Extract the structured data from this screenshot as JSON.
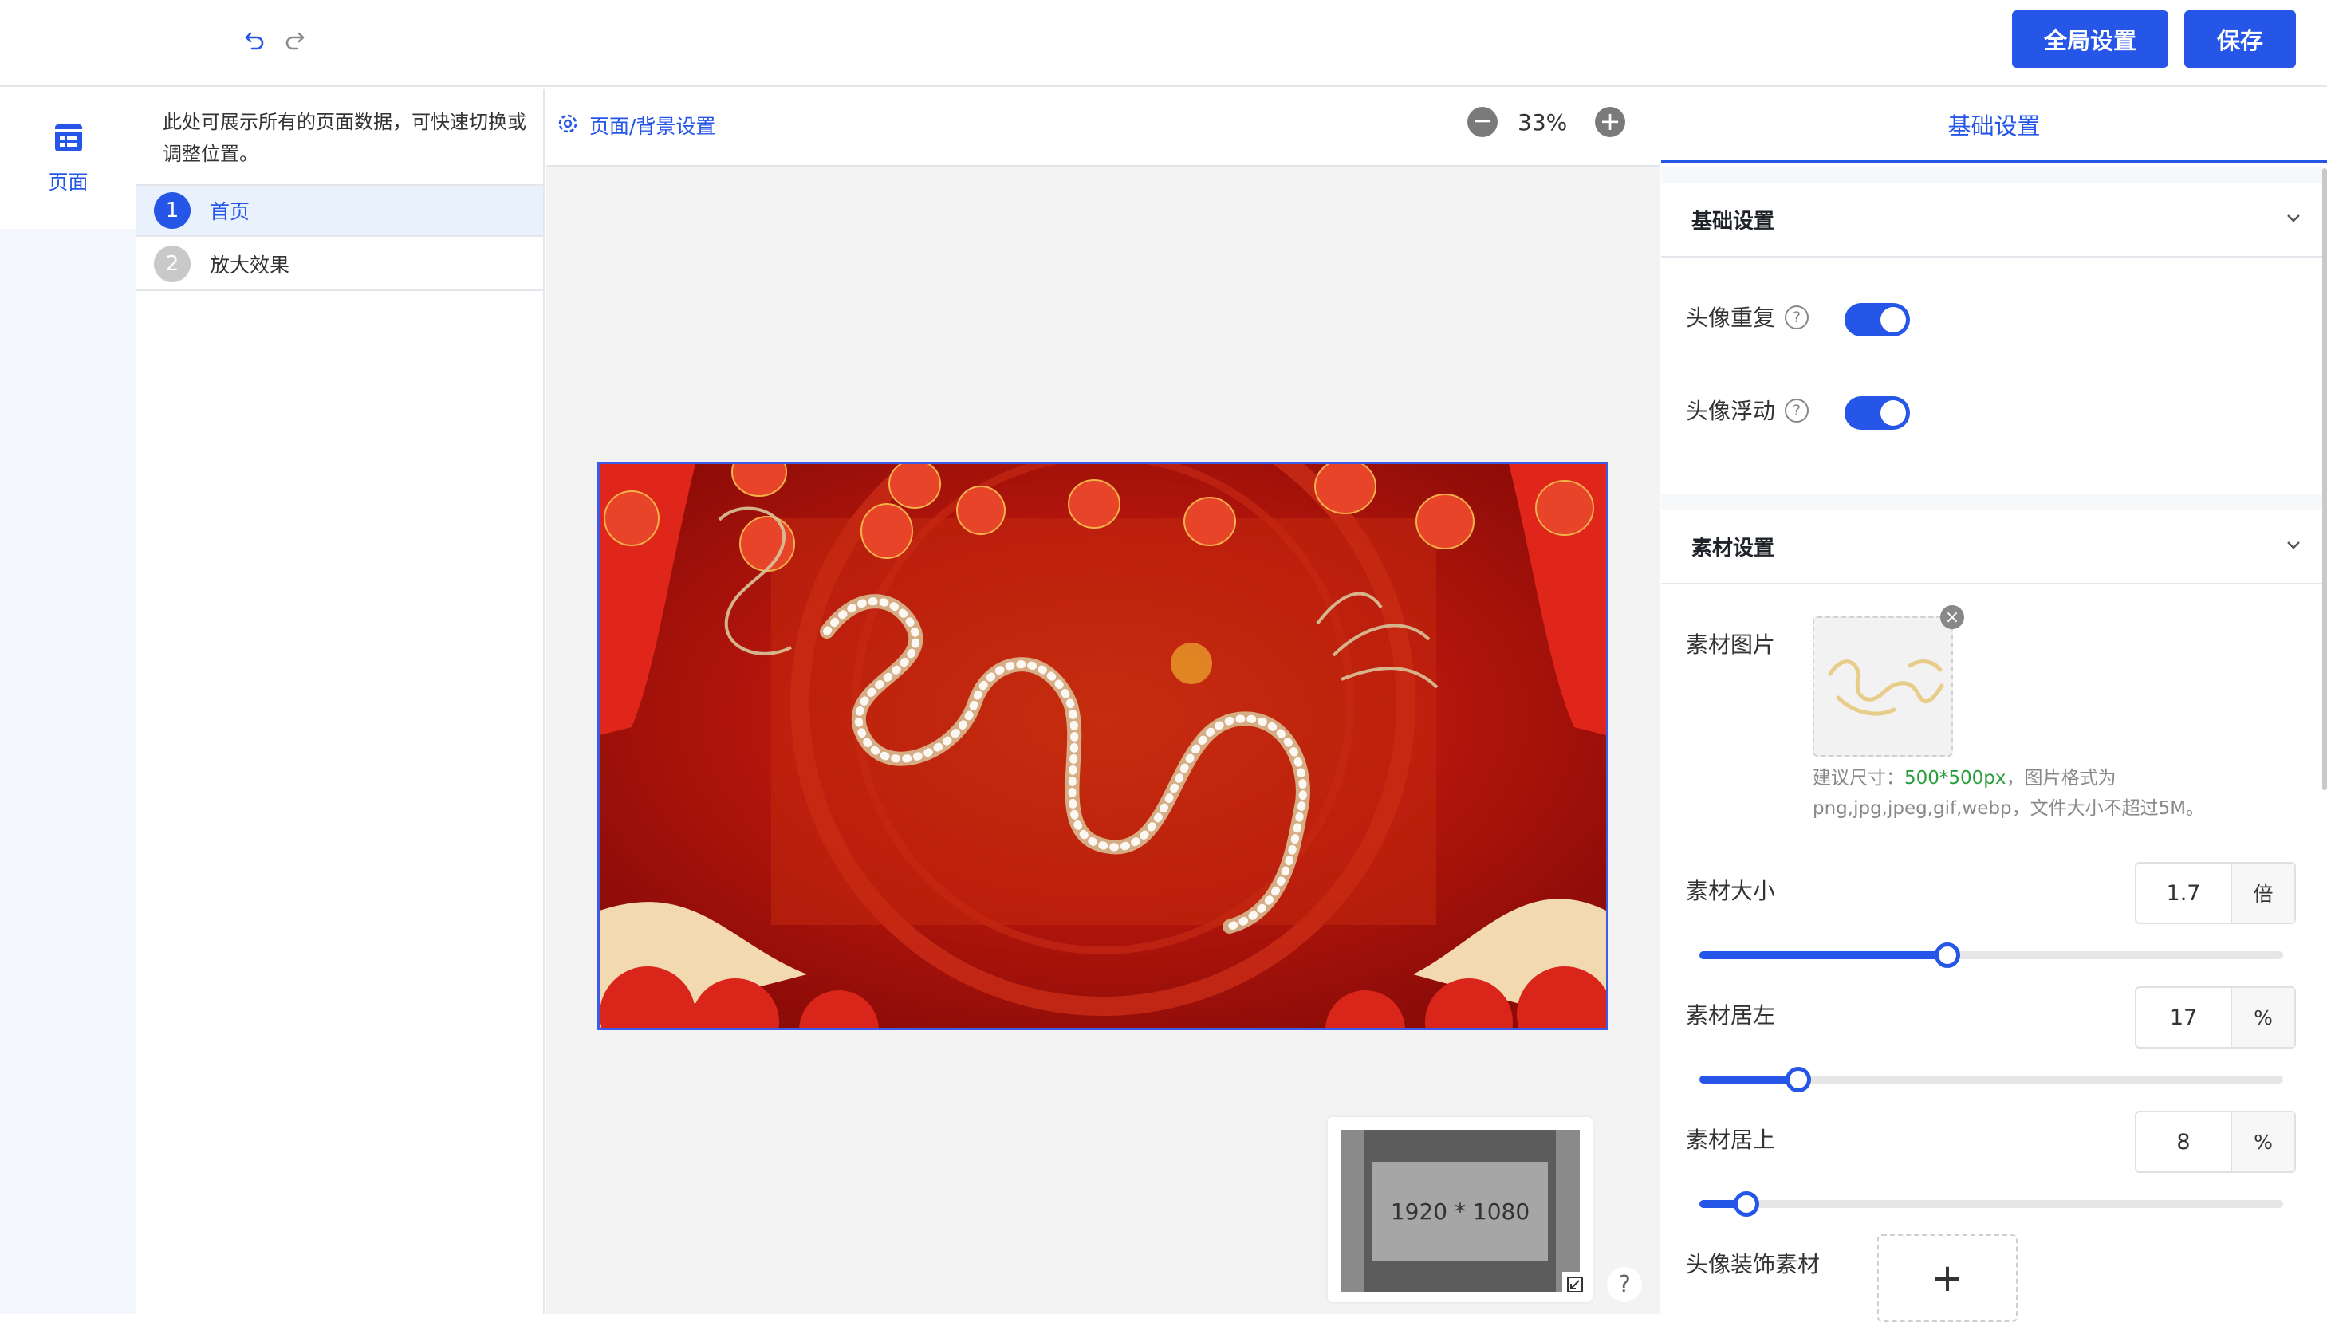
{
  "toolbar": {
    "undo_icon": "undo-icon",
    "redo_icon": "redo-icon",
    "global_settings_label": "全局设置",
    "save_label": "保存",
    "accent_color": "#2656e8"
  },
  "leftnav": {
    "page_label": "页面",
    "page_icon": "page-layout-icon"
  },
  "pagelist": {
    "description": "此处可展示所有的页面数据，可快速切换或调整位置。",
    "pages": [
      {
        "index": "1",
        "name": "首页",
        "active": true
      },
      {
        "index": "2",
        "name": "放大效果",
        "active": false
      }
    ]
  },
  "canvas": {
    "bg_settings_label": "页面/背景设置",
    "zoom_out_icon": "minus-icon",
    "zoom_in_icon": "plus-icon",
    "zoom": "33%",
    "minimap_size": "1920 * 1080",
    "help": "?"
  },
  "panel": {
    "tab_label": "基础设置",
    "basic_section": {
      "title": "基础设置",
      "avatar_repeat": {
        "label": "头像重复",
        "on": true
      },
      "avatar_float": {
        "label": "头像浮动",
        "on": true
      }
    },
    "material_section": {
      "title": "素材设置",
      "image_label": "素材图片",
      "hint_prefix": "建议尺寸：",
      "hint_size": "500*500px",
      "hint_suffix": "，图片格式为png,jpg,jpeg,gif,webp，文件大小不超过5M。",
      "size": {
        "label": "素材大小",
        "value": "1.7",
        "unit": "倍",
        "fraction": 0.425
      },
      "left": {
        "label": "素材居左",
        "value": "17",
        "unit": "%",
        "fraction": 0.17
      },
      "top": {
        "label": "素材居上",
        "value": "8",
        "unit": "%",
        "fraction": 0.08
      },
      "decor_label": "头像装饰素材",
      "add_symbol": "+"
    }
  }
}
